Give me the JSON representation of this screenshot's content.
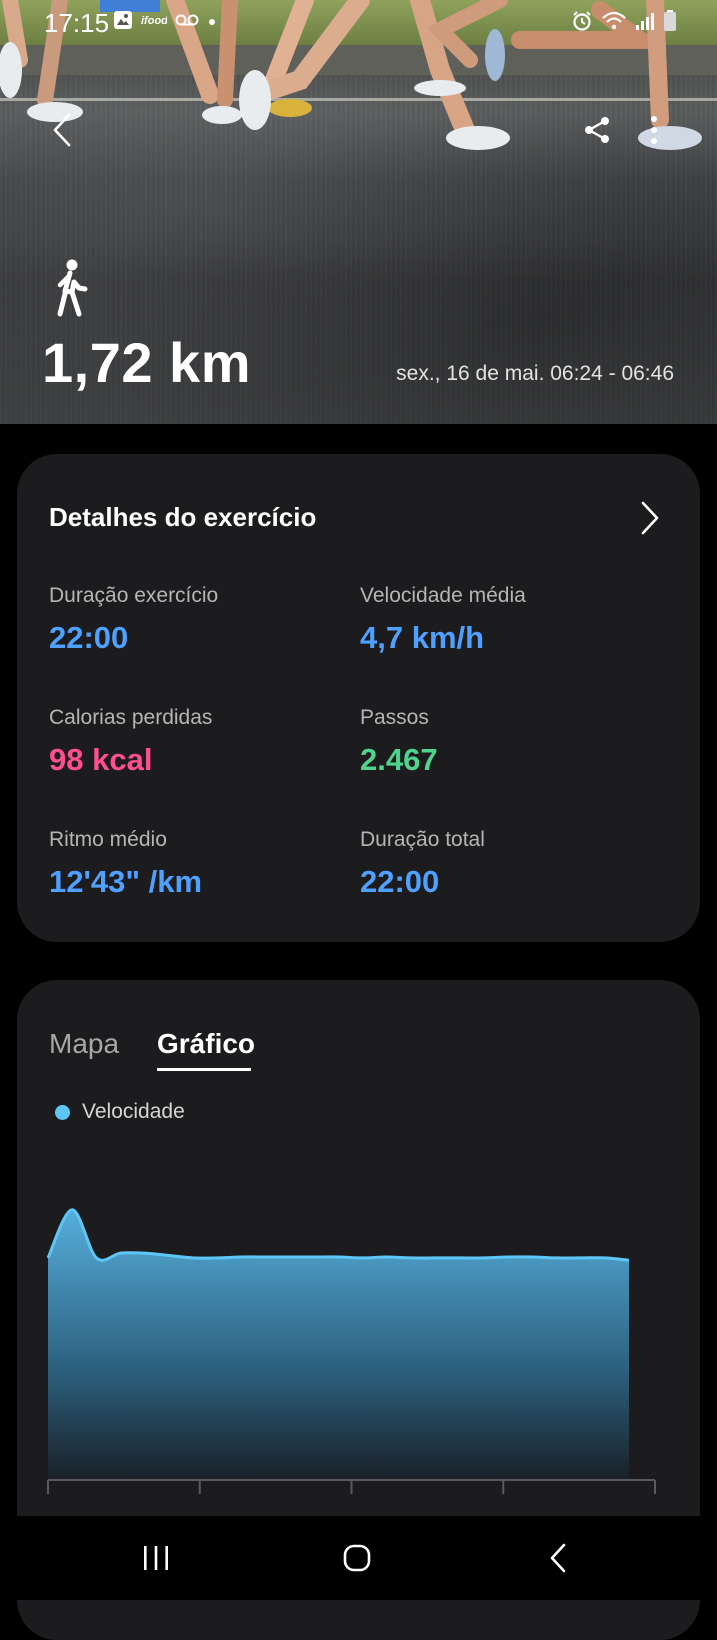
{
  "status_bar": {
    "time": "17:15",
    "left_icons": [
      "gallery-icon",
      "app-notification-icon",
      "voicemail-icon",
      "dot-icon"
    ],
    "right_icons": [
      "alarm-icon",
      "wifi-icon",
      "signal-icon",
      "battery-icon"
    ]
  },
  "header": {
    "back_icon": "back-arrow-icon",
    "share_icon": "share-icon",
    "more_icon": "more-vertical-icon"
  },
  "activity": {
    "type_icon": "walking-icon",
    "distance": "1,72 km",
    "date_range": "sex., 16 de mai. 06:24 - 06:46"
  },
  "details_card": {
    "title": "Detalhes do exercício",
    "stats": [
      {
        "label": "Duração exercício",
        "value": "22:00",
        "color": "#4ea1ff"
      },
      {
        "label": "Velocidade média",
        "value": "4,7 km/h",
        "color": "#4ea1ff"
      },
      {
        "label": "Calorias perdidas",
        "value": "98 kcal",
        "color": "#ff4f8f"
      },
      {
        "label": "Passos",
        "value": "2.467",
        "color": "#4fd38d"
      },
      {
        "label": "Ritmo médio",
        "value": "12'43\" /km",
        "color": "#4ea1ff"
      },
      {
        "label": "Duração total",
        "value": "22:00",
        "color": "#4ea1ff"
      }
    ]
  },
  "chart_card": {
    "tabs": [
      {
        "label": "Mapa",
        "active": false
      },
      {
        "label": "Gráfico",
        "active": true
      }
    ],
    "legend": "Velocidade"
  },
  "chart_data": {
    "type": "area",
    "title": "",
    "xlabel": "",
    "ylabel": "",
    "series": [
      {
        "name": "Velocidade",
        "color": "#5ec6f6",
        "values": [
          4.6,
          5.6,
          4.6,
          4.7,
          4.7,
          4.65,
          4.6,
          4.6,
          4.62,
          4.62,
          4.62,
          4.62,
          4.62,
          4.6,
          4.62,
          4.6,
          4.6,
          4.6,
          4.6,
          4.62,
          4.62,
          4.6,
          4.6,
          4.6,
          4.55
        ]
      }
    ],
    "ylim": [
      0,
      5.8
    ],
    "grid": false,
    "legend_position": "top-left"
  },
  "nav": {
    "recents_icon": "recent-apps-icon",
    "home_icon": "home-icon",
    "back_icon": "nav-back-icon"
  }
}
